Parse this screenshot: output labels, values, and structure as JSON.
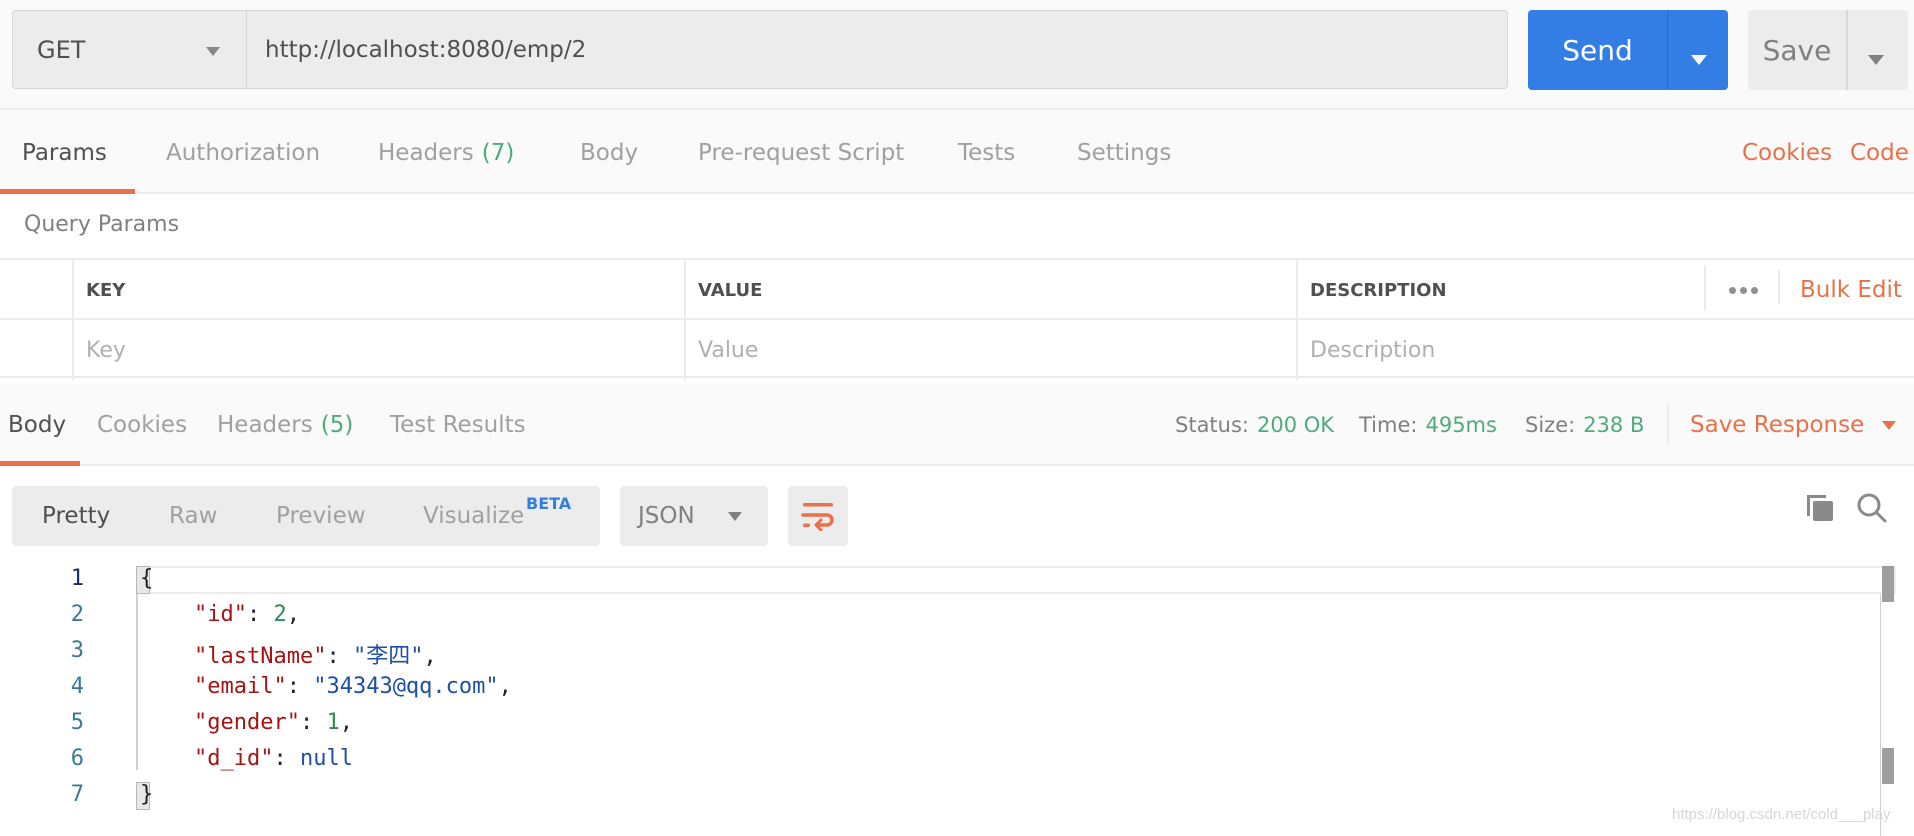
{
  "request": {
    "method": "GET",
    "url": "http://localhost:8080/emp/2",
    "send_label": "Send",
    "save_label": "Save"
  },
  "request_tabs": {
    "items": [
      {
        "label": "Params",
        "count": ""
      },
      {
        "label": "Authorization",
        "count": ""
      },
      {
        "label": "Headers",
        "count": "(7)"
      },
      {
        "label": "Body",
        "count": ""
      },
      {
        "label": "Pre-request Script",
        "count": ""
      },
      {
        "label": "Tests",
        "count": ""
      },
      {
        "label": "Settings",
        "count": ""
      }
    ],
    "active": "Params",
    "cookies_link": "Cookies",
    "code_link": "Code"
  },
  "query_params": {
    "title": "Query Params",
    "columns": [
      "KEY",
      "VALUE",
      "DESCRIPTION"
    ],
    "placeholders": {
      "key": "Key",
      "value": "Value",
      "description": "Description"
    },
    "bulk_edit": "Bulk Edit"
  },
  "response_tabs": {
    "items": [
      {
        "label": "Body",
        "count": ""
      },
      {
        "label": "Cookies",
        "count": ""
      },
      {
        "label": "Headers",
        "count": "(5)"
      },
      {
        "label": "Test Results",
        "count": ""
      }
    ],
    "active": "Body",
    "status_label": "Status:",
    "status_value": "200 OK",
    "time_label": "Time:",
    "time_value": "495ms",
    "size_label": "Size:",
    "size_value": "238 B",
    "save_response": "Save Response"
  },
  "response_body": {
    "view_modes": [
      "Pretty",
      "Raw",
      "Preview",
      "Visualize"
    ],
    "active_mode": "Pretty",
    "beta_badge": "BETA",
    "format": "JSON",
    "line_numbers": [
      "1",
      "2",
      "3",
      "4",
      "5",
      "6",
      "7"
    ],
    "json": {
      "id": 2,
      "lastName": "李四",
      "email": "34343@qq.com",
      "gender": 1,
      "d_id": null
    }
  },
  "icons": {
    "wrap": "wrap-lines-icon",
    "copy": "copy-icon",
    "search": "search-icon"
  },
  "colors": {
    "accent_orange": "#e8714a",
    "send_blue": "#327ee4",
    "status_green": "#4fac7a"
  },
  "watermark": "https://blog.csdn.net/cold___play"
}
